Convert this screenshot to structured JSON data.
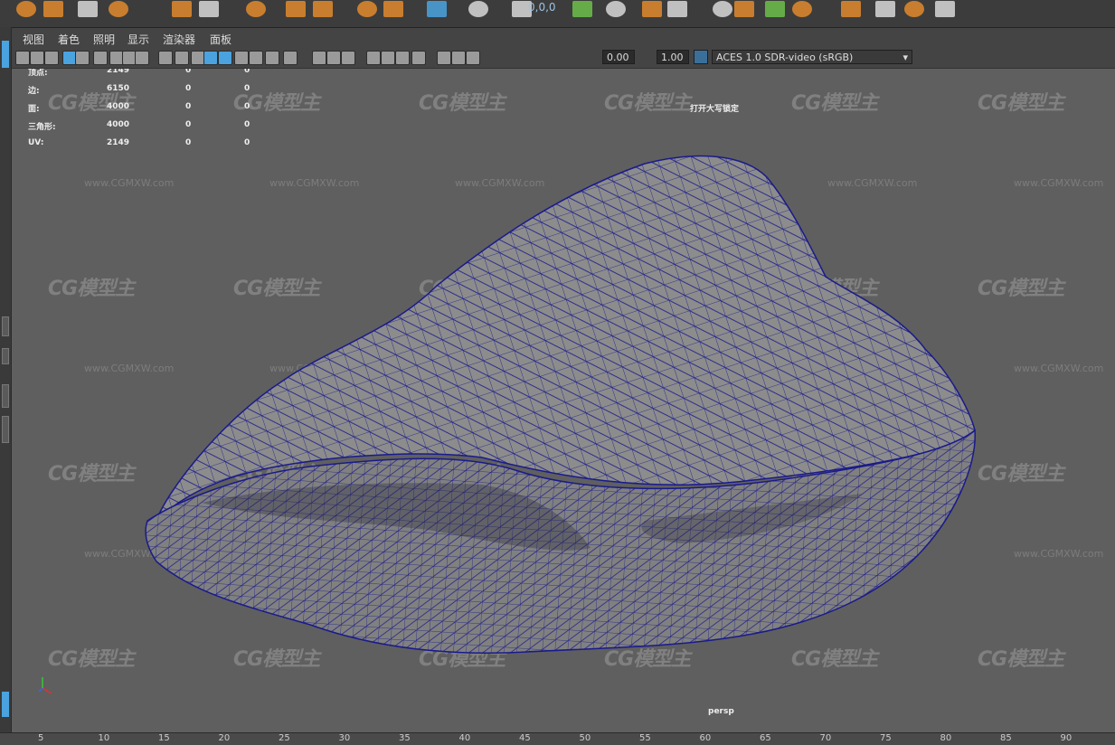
{
  "shelf": {
    "uv_readout": "0,0,0",
    "icons": [
      "sphere-icon",
      "cube-icon",
      "cylinder-icon",
      "cone-icon",
      "plane-icon",
      "torus-icon",
      "pipe-icon",
      "sprite-icon",
      "platonic-icon",
      "create-deformer-icon",
      "sweep-icon",
      "type-icon",
      "svg-icon",
      "uv-editor-icon",
      "uv-toolkit-icon",
      "snapshot-icon",
      "unfold-icon",
      "layout-icon",
      "normalize-icon",
      "checker-icon",
      "cut-icon",
      "sew-icon",
      "straighten-icon",
      "render-icon",
      "hypershade-icon",
      "light-icon"
    ]
  },
  "menu": {
    "items": [
      "视图",
      "着色",
      "照明",
      "显示",
      "渲染器",
      "面板"
    ]
  },
  "panel_toolbar": {
    "exposure": "0.00",
    "gamma": "1.00",
    "color_space": "ACES 1.0 SDR-video (sRGB)"
  },
  "hud": {
    "rows": [
      {
        "label": "顶点:",
        "value": "2149",
        "sel": "0",
        "comp": "0"
      },
      {
        "label": "边:",
        "value": "6150",
        "sel": "0",
        "comp": "0"
      },
      {
        "label": "面:",
        "value": "4000",
        "sel": "0",
        "comp": "0"
      },
      {
        "label": "三角形:",
        "value": "4000",
        "sel": "0",
        "comp": "0"
      },
      {
        "label": "UV:",
        "value": "2149",
        "sel": "0",
        "comp": "0"
      }
    ],
    "caps_lock": "打开大写锁定",
    "camera": "persp"
  },
  "watermark": {
    "logo": "CG模型主",
    "url": "www.CGMXW.com"
  },
  "timeline": {
    "ticks": [
      "5",
      "10",
      "15",
      "20",
      "25",
      "30",
      "35",
      "40",
      "45",
      "50",
      "55",
      "60",
      "65",
      "70",
      "75",
      "80",
      "85",
      "90"
    ]
  },
  "colors": {
    "viewport_bg": "#5f5f5f",
    "wireframe": "#1a1a8c",
    "mesh_fill": "#8c8c8c",
    "accent_blue": "#4aa3df"
  }
}
